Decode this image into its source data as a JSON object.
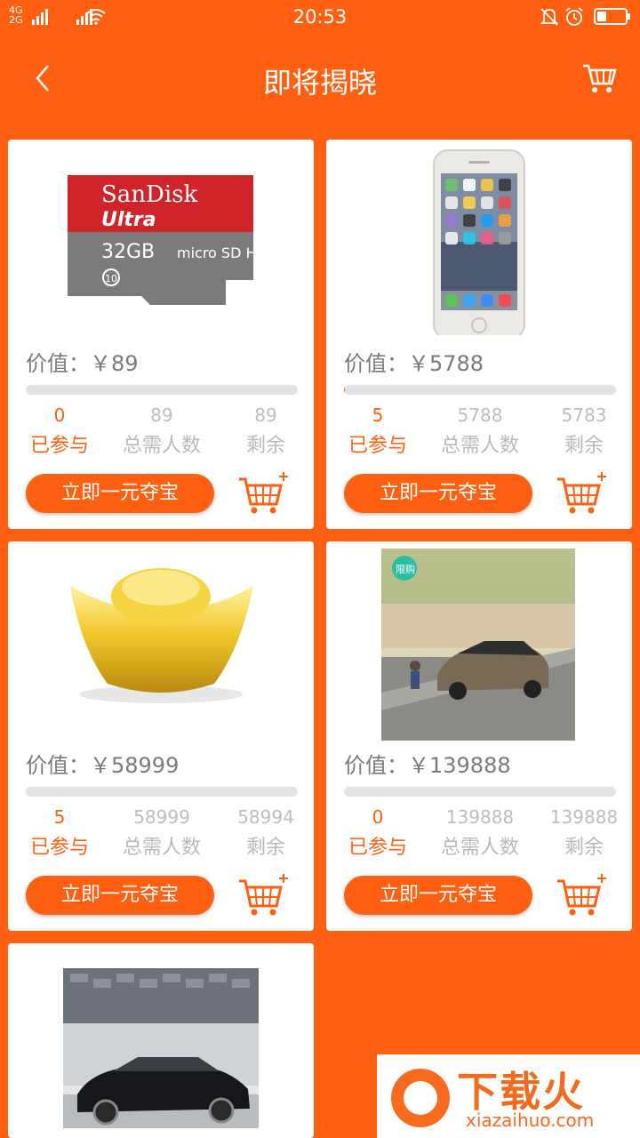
{
  "status_bar": {
    "time": "20:53",
    "network_1": "4G",
    "network_2": "2G",
    "icons": [
      "signal-icon",
      "wifi-icon",
      "mute-icon",
      "alarm-icon",
      "battery-icon"
    ]
  },
  "header": {
    "title": "即将揭晓",
    "back_icon": "back-arrow-icon",
    "cart_icon": "cart-icon"
  },
  "labels": {
    "price_prefix": "价值：",
    "joined": "已参与",
    "total": "总需人数",
    "remaining": "剩余",
    "buy_button": "立即一元夺宝"
  },
  "products": [
    {
      "name": "SanDisk Ultra 32GB microSD",
      "price": "￥89",
      "joined": "0",
      "total": "89",
      "remaining": "89",
      "progress": 0,
      "image_text": {
        "brand": "SanDisk",
        "line": "Ultra",
        "capacity": "32GB",
        "logo": "micro SD HC I",
        "class": "10"
      }
    },
    {
      "name": "iPhone",
      "price": "￥5788",
      "joined": "5",
      "total": "5788",
      "remaining": "5783",
      "progress": 0.0009
    },
    {
      "name": "Gold ingot",
      "price": "￥58999",
      "joined": "5",
      "total": "58999",
      "remaining": "58994",
      "progress": 0.0001
    },
    {
      "name": "Buick sedan",
      "price": "￥139888",
      "joined": "0",
      "total": "139888",
      "remaining": "139888",
      "progress": 0,
      "image_text": {
        "badge": "限购"
      }
    },
    {
      "name": "BMW sedan"
    }
  ],
  "watermark": {
    "brand": "下载火",
    "url": "xiazaihuo.com"
  },
  "colors": {
    "accent": "#fe5f11",
    "progress_track": "#e3e3e3",
    "muted_text": "#7a7a7a"
  }
}
